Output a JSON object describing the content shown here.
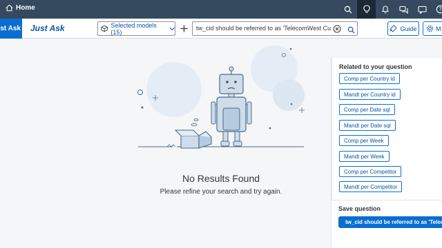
{
  "shell": {
    "home_label": "Home",
    "icons": [
      "search-icon",
      "lightbulb-icon",
      "bell-icon",
      "chat-icon",
      "feedback-icon",
      "help-icon"
    ]
  },
  "subheader": {
    "app_tab_label": "Just Ask",
    "title": "Just Ask",
    "models_label": "Selected models (15)",
    "search_value": "tw_cid should be referred to as 'TelecomWest Customer'",
    "guide_label": "Guide",
    "more_label": "M"
  },
  "main": {
    "no_results_title": "No Results Found",
    "no_results_subtitle": "Please refine your search and try again."
  },
  "related": {
    "heading": "Related to your question",
    "chips": [
      "Comp per Country id",
      "Mandt per Country id",
      "Comp per Date sql",
      "Mandt per Date sql",
      "Comp per Week",
      "Mandt per Week",
      "Comp per Competitor",
      "Mandt per Competitor"
    ]
  },
  "save": {
    "heading": "Save question",
    "button_label": "tw_cid should be referred to as 'TelecomWest Customer'"
  },
  "colors": {
    "shell": "#354a5f",
    "accent": "#0a6ed1",
    "link": "#0854a0"
  }
}
